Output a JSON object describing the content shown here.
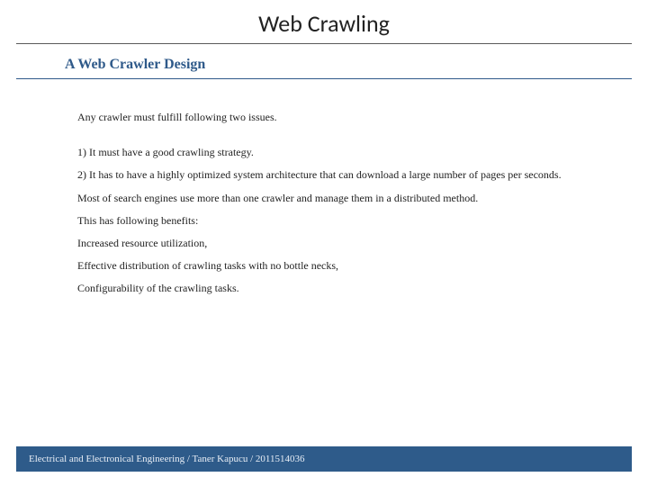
{
  "title": "Web Crawling",
  "subtitle": "A Web Crawler Design",
  "body": {
    "intro": "Any crawler must fulfill following two issues.",
    "p1": "1) It must have a good crawling strategy.",
    "p2": "2) It has to have a highly optimized system architecture that can download a large number of pages per seconds.",
    "p3": "Most of search engines use more than one crawler and manage them in a distributed method.",
    "p4": "This has following benefits:",
    "p5": "Increased resource utilization,",
    "p6": "Effective distribution of crawling tasks with no bottle necks,",
    "p7": "Configurability of the crawling tasks."
  },
  "footer": "Electrical and Electronical Engineering / Taner Kapucu /  2011514036"
}
